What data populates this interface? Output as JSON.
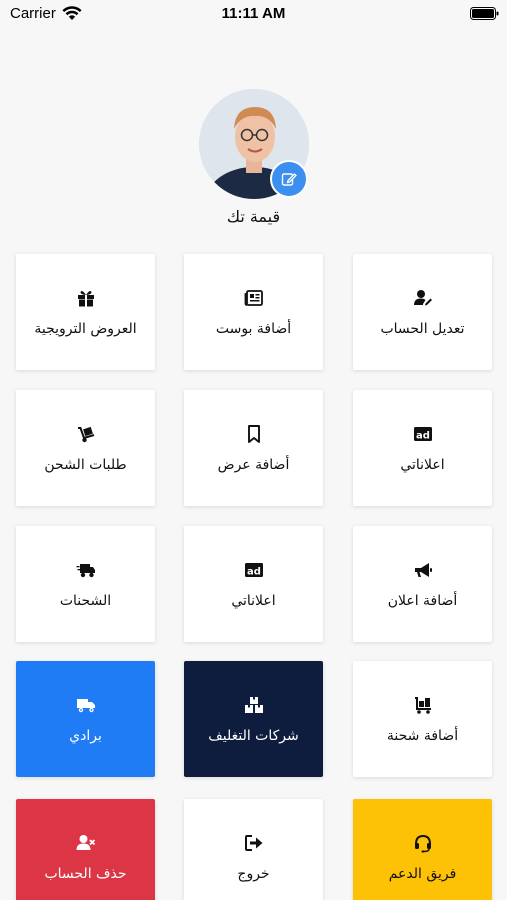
{
  "status_bar": {
    "carrier": "Carrier",
    "time": "11:11 AM"
  },
  "profile": {
    "name": "قيمة تك",
    "edit_icon": "edit-icon"
  },
  "colors": {
    "primary_blue": "#1f7cf5",
    "navy": "#0e1c3d",
    "danger_red": "#dc3545",
    "warning_yellow": "#fdc106",
    "badge_blue": "#3b8fef"
  },
  "menu": [
    {
      "label": "تعديل الحساب",
      "icon": "user-edit-icon"
    },
    {
      "label": "أضافة بوست",
      "icon": "newspaper-icon"
    },
    {
      "label": "العروض الترويجية",
      "icon": "gift-icon"
    },
    {
      "label": "اعلاناتي",
      "icon": "ad-icon"
    },
    {
      "label": "أضافة عرض",
      "icon": "bookmark-icon"
    },
    {
      "label": "طلبات الشحن",
      "icon": "dolly-icon"
    },
    {
      "label": "أضافة اعلان",
      "icon": "megaphone-icon"
    },
    {
      "label": "اعلاناتي",
      "icon": "ad-icon"
    },
    {
      "label": "الشحنات",
      "icon": "shipping-fast-icon"
    },
    {
      "label": "أضافة شحنة",
      "icon": "dolly-flatbed-icon"
    },
    {
      "label": "شركات التغليف",
      "icon": "boxes-icon"
    },
    {
      "label": "برادي",
      "icon": "truck-icon"
    },
    {
      "label": "فريق الدعم",
      "icon": "headset-icon"
    },
    {
      "label": "خروج",
      "icon": "sign-out-icon"
    },
    {
      "label": "حذف الحساب",
      "icon": "user-remove-icon"
    }
  ]
}
